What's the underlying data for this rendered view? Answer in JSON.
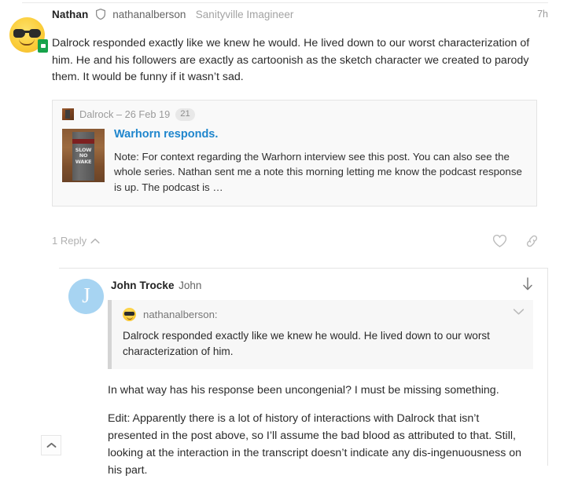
{
  "post_one": {
    "author_name": "Nathan",
    "author_handle": "nathanalberson",
    "author_title": "Sanityville Imagineer",
    "timestamp": "7h",
    "moderator_icon": "shield-icon",
    "avatar_icon": "sunglasses-emoji-avatar",
    "badge_icon": "green-id-badge-icon",
    "body": "Dalrock responded exactly like we knew he would. He lived down to our worst characterization of him. He and his followers are exactly as cartoonish as the sketch character we created to parody them. It would be funny if it wasn’t sad.",
    "onebox": {
      "source": "Dalrock – 26 Feb 19",
      "count": "21",
      "favicon_icon": "dalrock-favicon",
      "thumbnail_icon": "slow-no-wake-sign-thumbnail",
      "thumbnail_text": "SLOW NO WAKE",
      "title": "Warhorn responds.",
      "description": "Note:  For context regarding the Warhorn interview see this post.  You can also see the whole series. Nathan sent me a note this morning letting me know the podcast response is up.  The podcast is …"
    },
    "actions": {
      "replies_label": "1 Reply",
      "replies_chevron_icon": "chevron-up-icon",
      "like_icon": "heart-icon",
      "share_icon": "link-icon"
    }
  },
  "post_two": {
    "author_name": "John Trocke",
    "author_handle": "John",
    "avatar_letter": "J",
    "jump_icon": "arrow-down-icon",
    "quote": {
      "avatar_icon": "sunglasses-emoji-mini-avatar",
      "user": "nathanalberson:",
      "expand_icon": "chevron-down-icon",
      "text": "Dalrock responded exactly like we knew he would. He lived down to our worst characterization of him."
    },
    "paragraphs": [
      "In what way has his response been uncongenial? I must be missing something.",
      "Edit: Apparently there is a lot of history of interactions with Dalrock that isn’t presented in the post above, so I’ll assume the bad blood as attributed to that. Still, looking at the interaction in the transcript doesn’t indicate any dis-ingenuousness on his part."
    ]
  },
  "back_to_top": {
    "icon": "chevron-up-icon",
    "label": ""
  },
  "colors": {
    "link": "#1f86cd",
    "avatar_blue": "#a7d4f2",
    "muted_text": "#9c9c9c",
    "quote_border": "#d4d4d4",
    "card_bg": "#f9f9f9"
  }
}
